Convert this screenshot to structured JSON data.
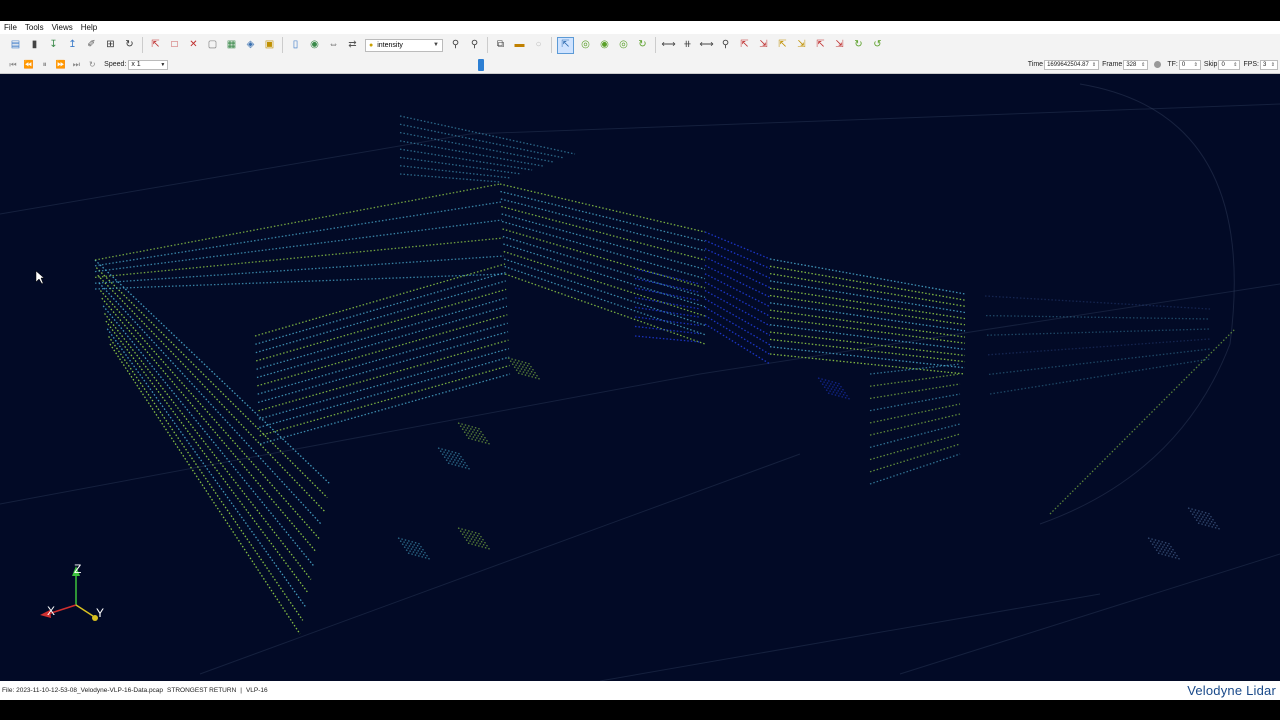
{
  "menu": [
    "File",
    "Tools",
    "Views",
    "Help"
  ],
  "toolbar": {
    "color_by": "intensity"
  },
  "player": {
    "speed_label": "Speed:",
    "speed_value": "x 1",
    "time_label": "Time",
    "time_value": "1699642504.87",
    "frame_label": "Frame",
    "frame_value": "328",
    "tf_label": "TF:",
    "tf_value": "0",
    "skip_label": "Skip",
    "skip_value": "0",
    "fps_label": "FPS:",
    "fps_value": "3",
    "timeline_position": 0.35
  },
  "viewport": {
    "axes": {
      "x": "X",
      "y": "Y",
      "z": "Z"
    },
    "colors": {
      "background": "#020a26",
      "high": "#9fe04a",
      "mid": "#4fb4d8",
      "low": "#1f3ad8"
    }
  },
  "status": {
    "file": "File: 2023-11-10-12-53-08_Velodyne-VLP-16-Data.pcap",
    "mode": "STRONGEST RETURN",
    "divider": "|",
    "sensor": "VLP-16"
  },
  "brand": "Velodyne Lidar"
}
